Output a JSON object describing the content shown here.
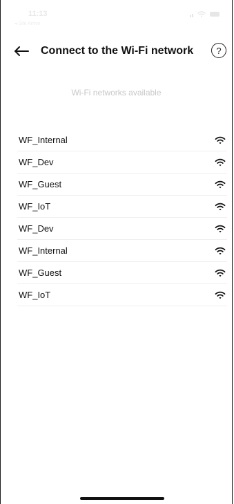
{
  "status_bar": {
    "time": "11:13",
    "back_app": "◂ Site Arrive"
  },
  "header": {
    "title": "Connect to the Wi-Fi network",
    "back_icon": "arrow-left-icon",
    "help_label": "?"
  },
  "section_label": "Wi-Fi networks available",
  "networks": [
    {
      "name": "WF_Internal",
      "icon": "wifi-icon"
    },
    {
      "name": "WF_Dev",
      "icon": "wifi-icon"
    },
    {
      "name": "WF_Guest",
      "icon": "wifi-icon"
    },
    {
      "name": "WF_IoT",
      "icon": "wifi-icon"
    },
    {
      "name": "WF_Dev",
      "icon": "wifi-icon"
    },
    {
      "name": "WF_Internal",
      "icon": "wifi-icon"
    },
    {
      "name": "WF_Guest",
      "icon": "wifi-icon"
    },
    {
      "name": "WF_IoT",
      "icon": "wifi-icon"
    }
  ],
  "colors": {
    "text": "#111111",
    "muted": "#c8c8c8",
    "divider": "#efefef",
    "status": "#e6e6e6"
  }
}
